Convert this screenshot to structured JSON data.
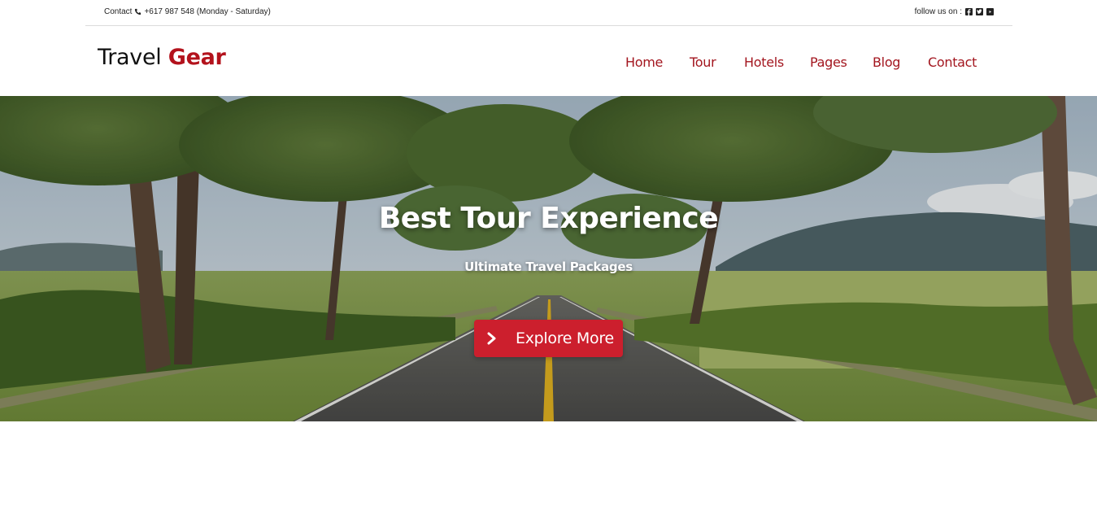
{
  "topbar": {
    "contact_label": "Contact",
    "contact_phone": "+617 987 548 (Monday - Saturday)",
    "follow_label": "follow us on :",
    "social_icons": [
      "facebook-icon",
      "twitter-icon",
      "youtube-icon"
    ]
  },
  "header": {
    "logo_part1": "Travel",
    "logo_part2": "Gear",
    "nav": [
      "Home",
      "Tour",
      "Hotels",
      "Pages",
      "Blog",
      "Contact"
    ]
  },
  "hero": {
    "title": "Best Tour Experience",
    "subtitle": "Ultimate Travel Packages",
    "button_label": "Explore More",
    "button_icon": "chevron-right-icon"
  },
  "colors": {
    "brand_red": "#b3121c",
    "nav_red": "#a3161f",
    "button_red": "#cc1f2d",
    "text_dark": "#222222"
  }
}
